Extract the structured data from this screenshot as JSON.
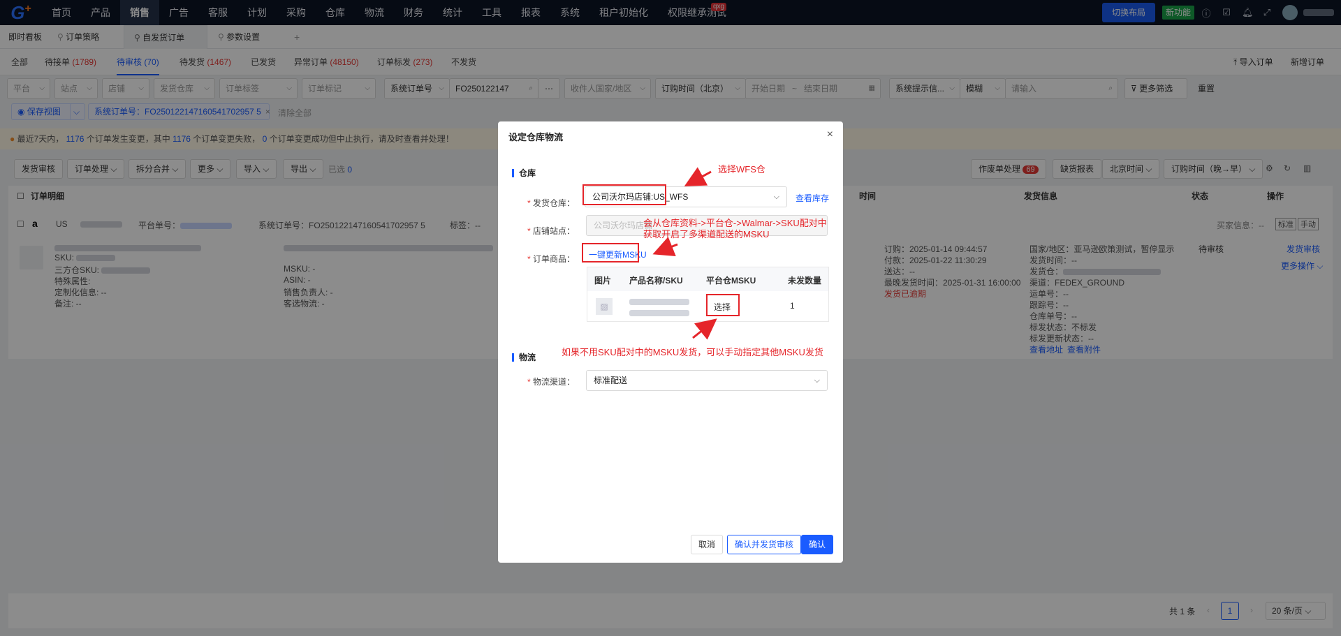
{
  "topnav": {
    "logo": "G",
    "items": [
      "首页",
      "产品",
      "销售",
      "广告",
      "客服",
      "计划",
      "采购",
      "仓库",
      "物流",
      "财务",
      "统计",
      "工具",
      "报表",
      "系统",
      "租户初始化",
      "权限继承测试"
    ],
    "active_index": 2,
    "badge": "qxg",
    "switch_layout": "切换布局",
    "new_feature": "新功能"
  },
  "pagetabs": {
    "items": [
      "即时看板",
      "订单策略",
      "自发货订单",
      "参数设置"
    ],
    "add": "+"
  },
  "status_tabs": [
    {
      "label": "全部",
      "count": ""
    },
    {
      "label": "待接单",
      "count": "(1789)"
    },
    {
      "label": "待审核",
      "count": "(70)"
    },
    {
      "label": "待发货",
      "count": "(1467)"
    },
    {
      "label": "已发货",
      "count": ""
    },
    {
      "label": "异常订单",
      "count": "(48150)"
    },
    {
      "label": "订单标发",
      "count": "(273)"
    },
    {
      "label": "不发货",
      "count": ""
    }
  ],
  "top_actions": {
    "import": "导入订单",
    "new": "新增订单"
  },
  "filters": {
    "platform": "平台",
    "site": "站点",
    "shop": "店铺",
    "warehouse": "发货仓库",
    "order_tag": "订单标签",
    "order_mark": "订单标记",
    "order_no_type": "系统订单号",
    "order_no_value": "FO250122147",
    "country": "收件人国家/地区",
    "time_type": "订购时间（北京）",
    "start_date": "开始日期",
    "end_date": "结束日期",
    "sys_hint": "系统提示信...",
    "match": "模糊",
    "input_placeholder": "请输入",
    "more": "更多筛选",
    "reset": "重置"
  },
  "chips": {
    "save_view": "保存视图",
    "filter_chip": "系统订单号：FO250122147160541702957 5",
    "clear": "清除全部"
  },
  "warning": {
    "p1": "最近7天内，",
    "n1": "1176",
    "p2": "个订单发生变更，其中",
    "n2": "1176",
    "p3": "个订单变更失败，",
    "n3": "0",
    "p4": "个订单变更成功但中止执行，请及时查看并处理！"
  },
  "actions": {
    "ship_review": "发货审核",
    "order_process": "订单处理",
    "split_merge": "拆分合并",
    "more": "更多",
    "import": "导入",
    "export": "导出",
    "selected": "已选",
    "selected_count": "0",
    "void": "作废单处理",
    "void_count": "69",
    "missing_report": "缺货报表",
    "bj_time": "北京时间",
    "sort": "订购时间（晚→早）"
  },
  "table": {
    "headers": {
      "detail": "订单明细",
      "time": "时间",
      "ship_info": "发货信息",
      "status": "状态",
      "ops": "操作"
    },
    "row": {
      "site": "US",
      "platform_no_label": "平台单号：",
      "sys_no_label": "系统订单号：",
      "sys_no": "FO250122147160541702957 5",
      "tag_label": "标签：--",
      "buyer_label": "买家信息：--",
      "btn_std": "标准",
      "btn_manual": "手动",
      "sku_label": "SKU:",
      "third_sku": "三方仓SKU:",
      "special": "特殊属性:",
      "custom": "定制化信息: --",
      "remark": "备注: --",
      "msku": "MSKU: -",
      "asin": "ASIN: -",
      "sales_owner": "销售负责人: -",
      "cust_logistics": "客选物流: -",
      "order_time": "订购：2025-01-14 09:44:57",
      "pay_time": "付款：2025-01-22 11:30:29",
      "deliver_time": "送达：--",
      "latest_ship": "最晚发货时间：2025-01-31 16:00:00",
      "overdue": "发货已逾期",
      "country": "国家/地区：亚马逊欧策测试，暂停显示",
      "ship_time": "发货时间：--",
      "ship_wh": "发货仓：",
      "channel": "渠道：FEDEX_GROUND",
      "tracking": "运单号：--",
      "track_no": "跟踪号：--",
      "wh_no": "仓库单号：--",
      "mark_status": "标发状态：不标发",
      "mark_update": "标发更新状态：--",
      "view_addr": "查看地址",
      "view_attach": "查看附件",
      "status": "待审核",
      "op_review": "发货审核",
      "op_more": "更多操作"
    }
  },
  "pager": {
    "total": "共 1 条",
    "page": "1",
    "size": "20 条/页"
  },
  "modal": {
    "title": "设定仓库物流",
    "section_wh": "仓库",
    "label_wh": "发货仓库：",
    "wh_value": "公司沃尔玛店铺:US_WFS",
    "view_stock": "查看库存",
    "label_site": "店铺站点：",
    "site_value": "公司沃尔玛店铺",
    "label_items": "订单商品：",
    "refresh_msku": "一键更新MSKU",
    "cols": [
      "图片",
      "产品名称/SKU",
      "平台仓MSKU",
      "未发数量"
    ],
    "select_link": "选择",
    "qty": "1",
    "section_log": "物流",
    "label_channel": "物流渠道：",
    "channel_value": "标准配送",
    "cancel": "取消",
    "confirm_review": "确认并发货审核",
    "confirm": "确认"
  },
  "annotations": {
    "a1": "选择WFS仓",
    "a2": "会从仓库资料->平台仓->Walmar->SKU配对中",
    "a3": "获取开启了多渠道配送的MSKU",
    "a4": "如果不用SKU配对中的MSKU发货，可以手动指定其他MSKU发货"
  },
  "icons": [
    "search-icon",
    "filter-icon",
    "eye-icon",
    "close-icon",
    "chevron-down-icon",
    "image-icon",
    "gear-icon",
    "refresh-icon",
    "arrow-icon"
  ]
}
